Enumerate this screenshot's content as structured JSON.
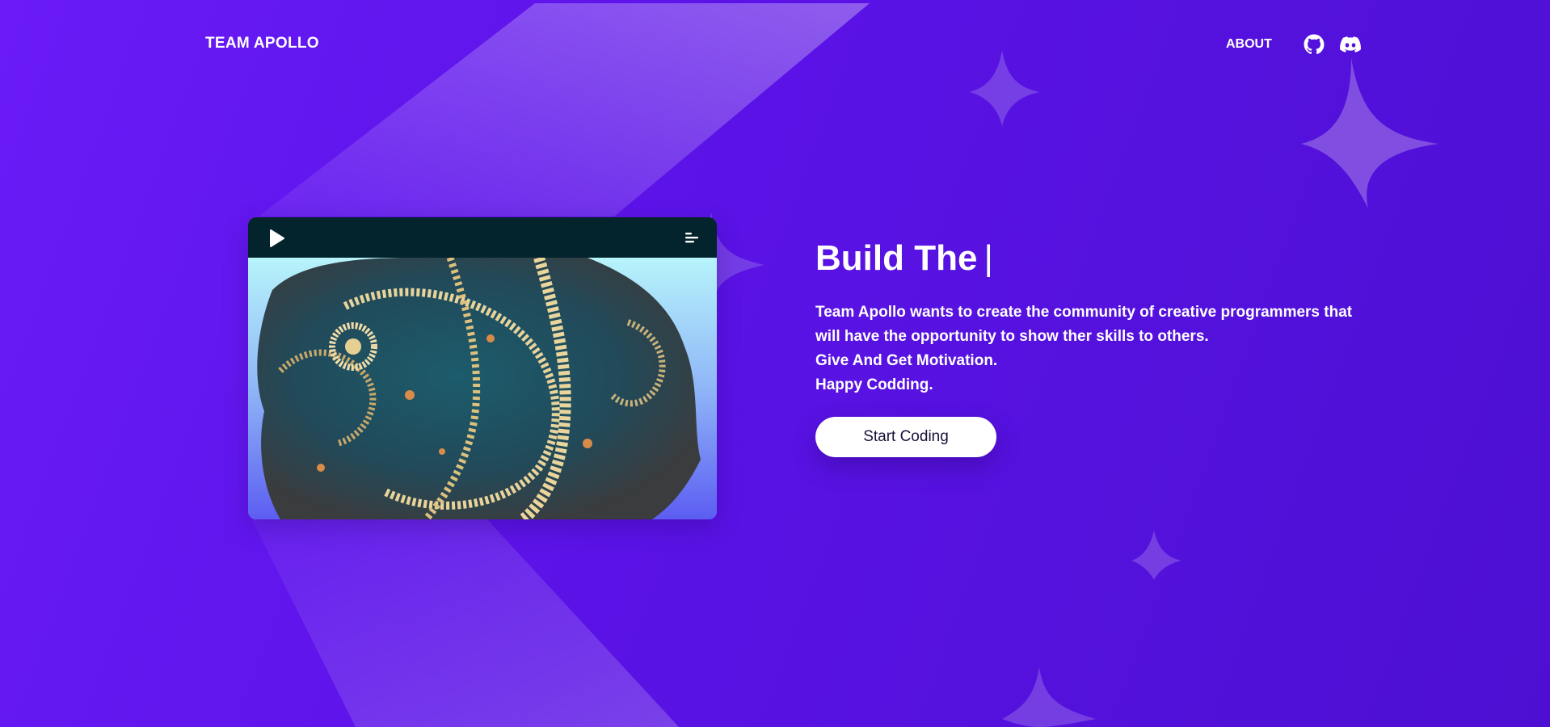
{
  "colors": {
    "background": "#5a12e6",
    "video_bar": "#03242c",
    "button_bg": "#ffffff",
    "button_text": "#16123a",
    "sparkle": "#8e63e6"
  },
  "nav": {
    "brand": "TEAM APOLLO",
    "about": "ABOUT",
    "icons": [
      "github-icon",
      "discord-icon"
    ]
  },
  "video": {
    "controls": [
      "play-icon",
      "menu-icon"
    ]
  },
  "hero": {
    "title": "Build The",
    "cursor": "|",
    "paragraph_lines": [
      "Team Apollo wants to create the community of creative programmers that will have the opportunity to show ther skills to others.",
      "Give And Get Motivation.",
      "Happy Codding."
    ],
    "cta_label": "Start Coding"
  }
}
